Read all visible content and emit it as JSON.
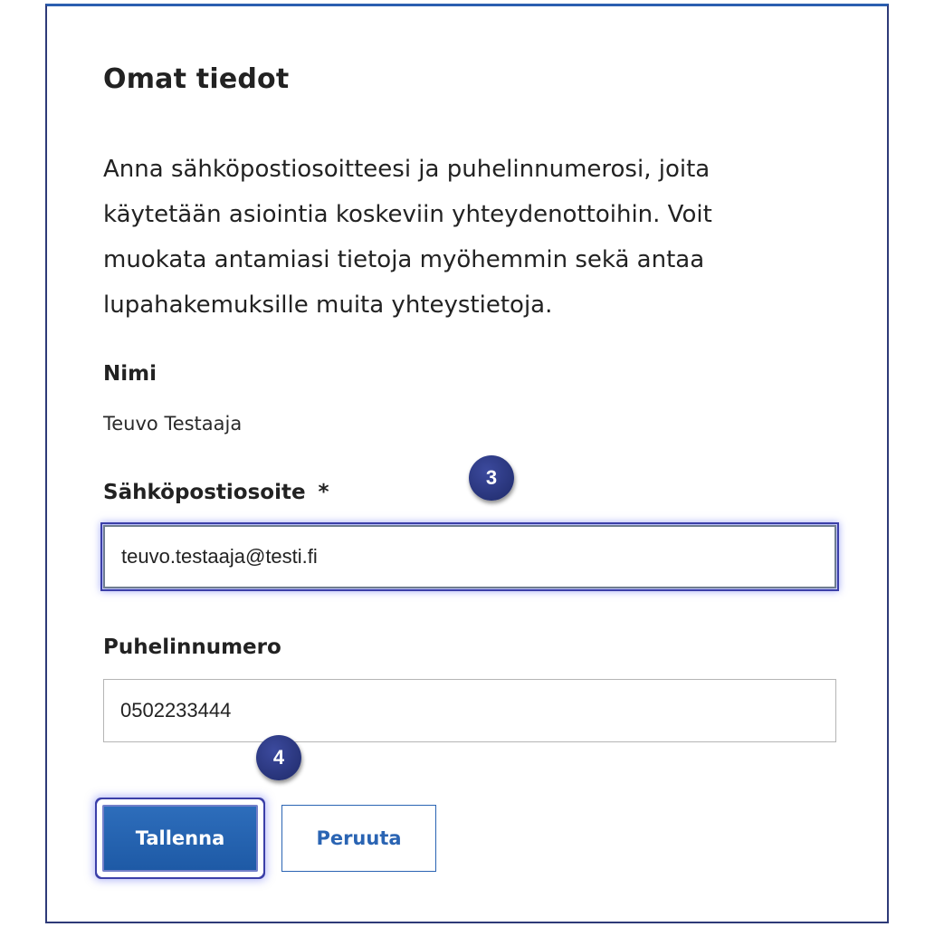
{
  "dialog": {
    "title": "Omat tiedot",
    "intro": "Anna sähköpostiosoitteesi ja puhelinnumerosi, joita käytetään asiointia koskeviin yhteydenottoihin. Voit muokata antamiasi tietoja myöhemmin sekä antaa lupahakemuksille muita yhteystietoja."
  },
  "name": {
    "label": "Nimi",
    "value": "Teuvo Testaaja"
  },
  "email": {
    "label": "Sähköpostiosoite",
    "required_marker": "*",
    "value": "teuvo.testaaja@testi.fi"
  },
  "phone": {
    "label": "Puhelinnumero",
    "value": "0502233444"
  },
  "buttons": {
    "save": "Tallenna",
    "cancel": "Peruuta"
  },
  "callouts": {
    "step_3": "3",
    "step_4": "4"
  },
  "colors": {
    "primary": "#1e5aa6",
    "callout": "#263276",
    "focus_glow": "#3b3fa8"
  }
}
